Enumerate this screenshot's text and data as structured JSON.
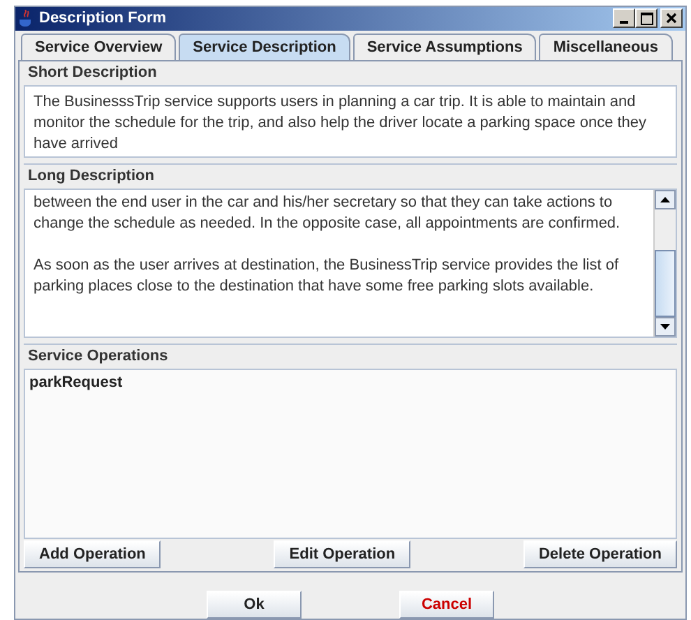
{
  "window": {
    "title": "Description Form"
  },
  "tabs": [
    {
      "label": "Service Overview",
      "selected": false
    },
    {
      "label": "Service Description",
      "selected": true
    },
    {
      "label": "Service Assumptions",
      "selected": false
    },
    {
      "label": "Miscellaneous",
      "selected": false
    }
  ],
  "short_description": {
    "label": "Short Description",
    "value": "The BusinesssTrip service supports users in planning a car trip. It is able to maintain and monitor the schedule for the trip, and also help the driver locate a parking space once they have arrived"
  },
  "long_description": {
    "label": "Long Description",
    "paragraphs": [
      "between the end user in the car and his/her secretary so that they can take actions to change the schedule as needed. In the opposite case, all appointments are confirmed.",
      "As soon as the user arrives at destination, the BusinessTrip service provides the list of parking places close to the destination that have some free parking slots available."
    ]
  },
  "service_operations": {
    "label": "Service Operations",
    "items": [
      "parkRequest"
    ],
    "buttons": [
      "Add Operation",
      "Edit Operation",
      "Delete Operation"
    ]
  },
  "dialog_buttons": [
    {
      "label": "Ok",
      "kind": "normal"
    },
    {
      "label": "Cancel",
      "kind": "danger"
    }
  ]
}
